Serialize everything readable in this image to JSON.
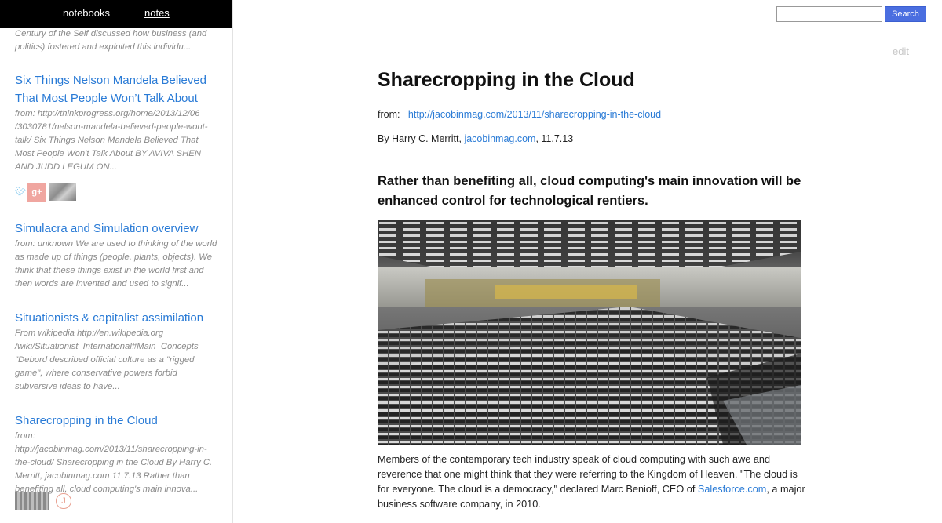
{
  "nav": {
    "notebooks": "notebooks",
    "notes": "notes"
  },
  "sidebar": {
    "top_snippet": "Century of the Self discussed how business (and politics) fostered and exploited this individu...",
    "notes": [
      {
        "title": "Six Things Nelson Mandela Believed That Most People Won’t Talk About",
        "snippet": "from: http://thinkprogress.org/home/2013/12/06 /3030781/nelson-mandela-believed-people-wont-talk/ Six Things Nelson Mandela Believed That Most People Won't Talk About BY AVIVA SHEN AND JUDD LEGUM ON..."
      },
      {
        "title": "Simulacra and Simulation overview",
        "snippet": "from: unknown We are used to thinking of the world as made up of things (people, plants, objects). We think that these things exist in the world first and then words are invented and used to signif..."
      },
      {
        "title": "Situationists & capitalist assimilation",
        "snippet": "From wikipedia http://en.wikipedia.org /wiki/Situationist_International#Main_Concepts \"Debord described official culture as a \"rigged game\", where conservative powers forbid subversive ideas to have..."
      },
      {
        "title": "Sharecropping in the Cloud",
        "snippet": "from:  http://jacobinmag.com/2013/11/sharecropping-in-the-cloud/ Sharecropping in the Cloud By Harry C. Merritt, jacobinmag.com 11.7.13 Rather than benefiting all, cloud computing's main innova..."
      }
    ],
    "gplus_label": "g+",
    "j_label": "J"
  },
  "search": {
    "placeholder": "",
    "button": "Search"
  },
  "edit_label": "edit",
  "article": {
    "title": "Sharecropping in the Cloud",
    "from_label": "from:",
    "from_url": "http://jacobinmag.com/2013/11/sharecropping-in-the-cloud",
    "byline_prefix": "By Harry C. Merritt,",
    "byline_link": "jacobinmag.com",
    "byline_suffix": ", 11.7.13",
    "lead": "Rather than benefiting all, cloud computing's main innovation will be enhanced control for technological rentiers.",
    "body_1": "Members of the contemporary tech industry speak of cloud computing with such awe and reverence that one might think that they were referring to the Kingdom of Heaven. \"The cloud is for everyone. The cloud is a democracy,\" declared Marc Benioff, CEO of",
    "body_link": "Salesforce.com",
    "body_2": ", a major business software company, in 2010."
  },
  "colors": {
    "link": "#2a7bd6",
    "nav_bg": "#000000",
    "search_button": "#4a6ee0"
  }
}
